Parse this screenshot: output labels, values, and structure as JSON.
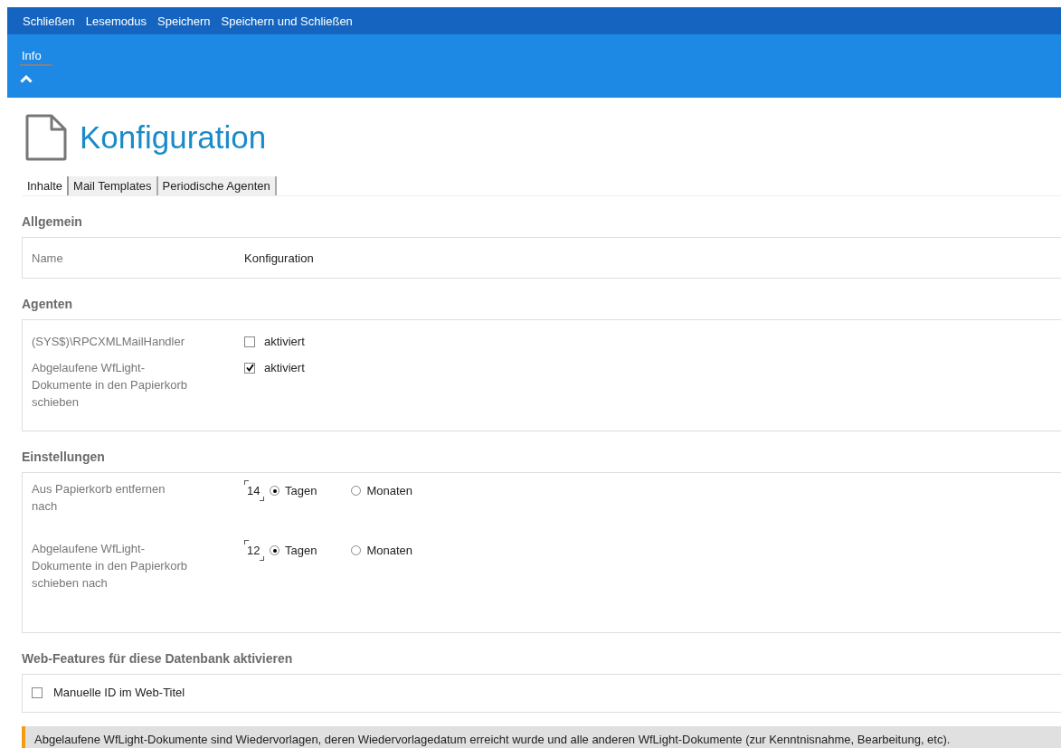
{
  "toolbar": [
    "Schließen",
    "Lesemodus",
    "Speichern",
    "Speichern und Schließen"
  ],
  "info_tabs": [
    {
      "label": "Info",
      "selected": true
    }
  ],
  "title": "Konfiguration",
  "tabs": [
    {
      "label": "Inhalte",
      "selected": true
    },
    {
      "label": "Mail Templates",
      "selected": false
    },
    {
      "label": "Periodische Agenten",
      "selected": false
    }
  ],
  "sections": [
    {
      "heading": "Allgemein",
      "rows": [
        {
          "kind": "text",
          "label": "Name",
          "value": "Konfiguration"
        }
      ]
    },
    {
      "heading": "Agenten",
      "rows": [
        {
          "kind": "checkbox",
          "label": "(SYS$)\\RPCXMLMailHandler",
          "option": "aktiviert",
          "checked": false
        },
        {
          "kind": "checkbox",
          "label": "Abgelaufene WfLight-Dokumente in den Papierkorb schieben",
          "option": "aktiviert",
          "checked": true
        }
      ]
    },
    {
      "heading": "Einstellungen",
      "rows": [
        {
          "kind": "duration",
          "label": "Aus Papierkorb entfernen nach",
          "value": "14",
          "options": [
            {
              "label": "Tagen",
              "selected": true
            },
            {
              "label": "Monaten",
              "selected": false
            }
          ]
        },
        {
          "kind": "duration",
          "label": "Abgelaufene WfLight-Dokumente in den Papierkorb schieben nach",
          "value": "12",
          "options": [
            {
              "label": "Tagen",
              "selected": true
            },
            {
              "label": "Monaten",
              "selected": false
            }
          ]
        }
      ]
    },
    {
      "heading": "Web-Features für diese Datenbank aktivieren",
      "rows": [
        {
          "kind": "checkbox-only",
          "option": "Manuelle ID im Web-Titel",
          "checked": false
        }
      ]
    }
  ],
  "note": "Abgelaufene WfLight-Dokumente sind Wiedervorlagen, deren Wiedervorlagedatum erreicht wurde und alle anderen WfLight-Dokumente (zur Kenntnisnahme, Bearbeitung, etc)."
}
